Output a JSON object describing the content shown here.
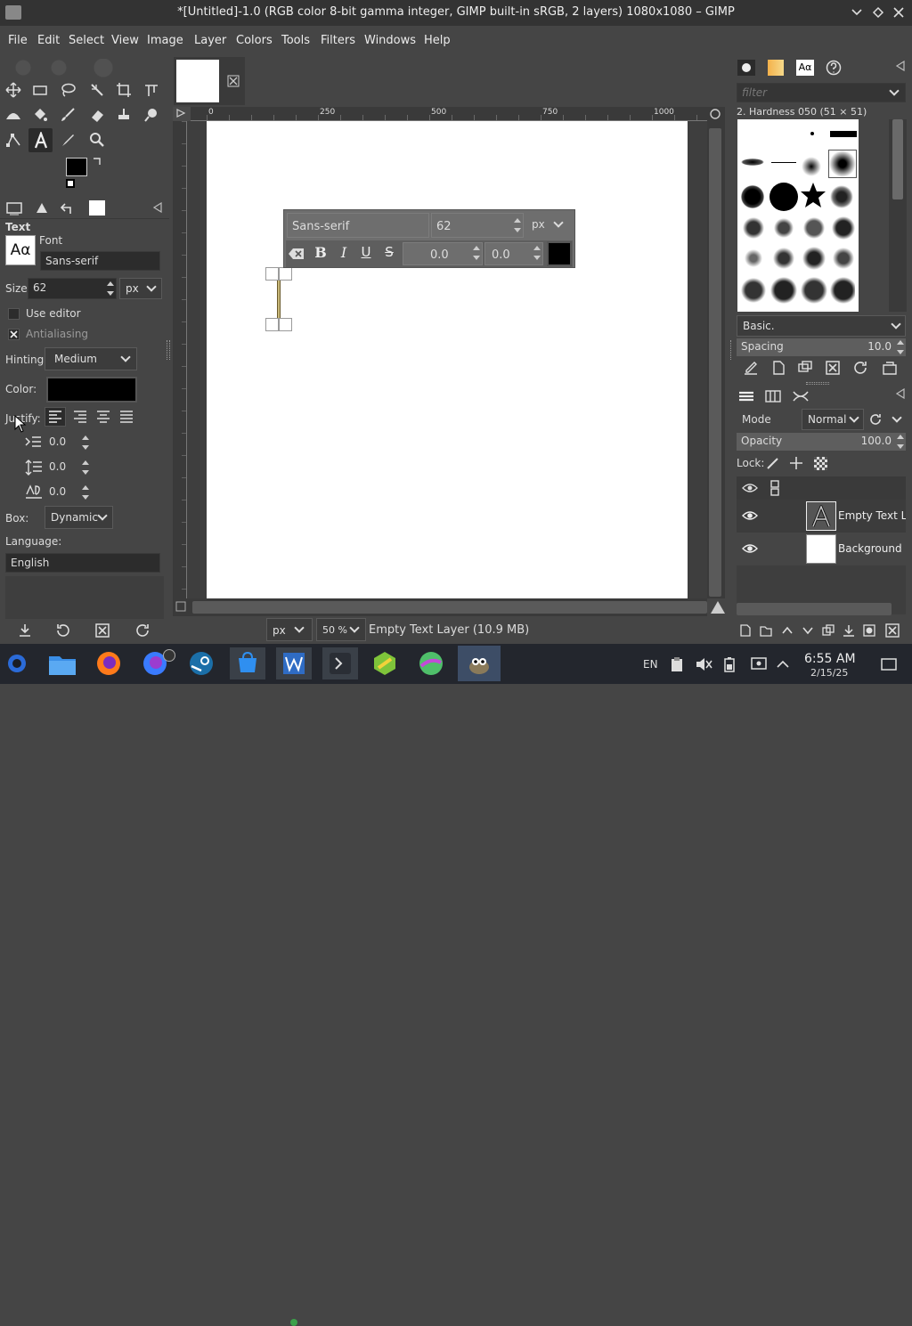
{
  "window": {
    "title": "*[Untitled]-1.0 (RGB color 8-bit gamma integer, GIMP built-in sRGB, 2 layers) 1080x1080 – GIMP"
  },
  "menu": [
    "File",
    "Edit",
    "Select",
    "View",
    "Image",
    "Layer",
    "Colors",
    "Tools",
    "Filters",
    "Windows",
    "Help"
  ],
  "tool_options": {
    "section": "Text",
    "font_label": "Font",
    "font_value": "Sans-serif",
    "size_label": "Size:",
    "size_value": "62",
    "size_unit": "px",
    "use_editor": "Use editor",
    "antialiasing": "Antialiasing",
    "hinting_label": "Hinting:",
    "hinting_value": "Medium",
    "color_label": "Color:",
    "justify_label": "Justify:",
    "indent_value": "0.0",
    "line_spacing_value": "0.0",
    "letter_spacing_value": "0.0",
    "box_label": "Box:",
    "box_value": "Dynamic",
    "language_label": "Language:",
    "language_value": "English",
    "font_preview": "Aα"
  },
  "text_toolbar": {
    "font": "Sans-serif",
    "size": "62",
    "unit": "px",
    "bold": "B",
    "italic": "I",
    "underline": "U",
    "strike": "S",
    "baseline": "0.0",
    "kerning": "0.0"
  },
  "ruler": {
    "marks": [
      "0",
      "250",
      "500",
      "750",
      "1000"
    ]
  },
  "status": {
    "unit": "px",
    "zoom": "50 %",
    "message": "Empty Text Layer (10.9 MB)"
  },
  "brushes": {
    "filter_placeholder": "filter",
    "selected": "2. Hardness 050 (51 × 51)",
    "preset": "Basic.",
    "spacing_label": "Spacing",
    "spacing_value": "10.0"
  },
  "layers": {
    "mode_label": "Mode",
    "mode_value": "Normal",
    "opacity_label": "Opacity",
    "opacity_value": "100.0",
    "lock_label": "Lock:",
    "items": [
      {
        "name": "Empty Text Lay"
      },
      {
        "name": "Background"
      }
    ]
  },
  "taskbar": {
    "lang": "EN",
    "time": "6:55 AM",
    "date": "2/15/25"
  }
}
